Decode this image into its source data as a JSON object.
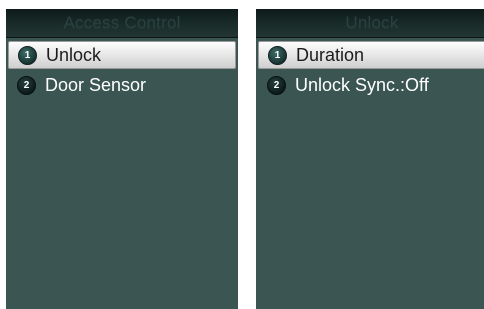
{
  "screens": [
    {
      "title": "Access Control",
      "items": [
        {
          "number": "1",
          "label": "Unlock",
          "selected": true
        },
        {
          "number": "2",
          "label": "Door Sensor",
          "selected": false
        }
      ]
    },
    {
      "title": "Unlock",
      "items": [
        {
          "number": "1",
          "label": "Duration",
          "selected": true
        },
        {
          "number": "2",
          "label": "Unlock Sync.:Off",
          "selected": false
        }
      ]
    }
  ],
  "colors": {
    "screen_background": "#3a5552",
    "title_bar": "#1b2d2b",
    "selected_highlight": "#e9e9e9",
    "text_normal": "#ffffff",
    "text_selected": "#1c1c1c"
  }
}
